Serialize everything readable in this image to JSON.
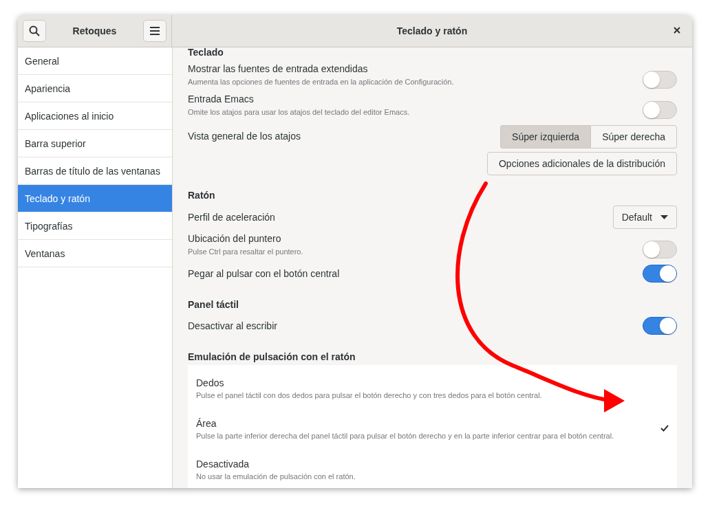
{
  "window": {
    "title": "Teclado y ratón"
  },
  "sidebar": {
    "title": "Retoques",
    "items": [
      {
        "label": "General",
        "selected": false
      },
      {
        "label": "Apariencia",
        "selected": false
      },
      {
        "label": "Aplicaciones al inicio",
        "selected": false
      },
      {
        "label": "Barra superior",
        "selected": false
      },
      {
        "label": "Barras de título de las ventanas",
        "selected": false
      },
      {
        "label": "Teclado y ratón",
        "selected": true
      },
      {
        "label": "Tipografías",
        "selected": false
      },
      {
        "label": "Ventanas",
        "selected": false
      }
    ]
  },
  "sections": [
    {
      "heading": "Teclado",
      "rows": [
        {
          "kind": "switch",
          "label": "Mostrar las fuentes de entrada extendidas",
          "description": "Aumenta las opciones de fuentes de entrada en la aplicación de Configuración.",
          "on": false
        },
        {
          "kind": "switch",
          "label": "Entrada Emacs",
          "description": "Omite los atajos para usar los atajos del teclado del editor Emacs.",
          "on": false
        },
        {
          "kind": "segmented",
          "label": "Vista general de los atajos",
          "options": [
            {
              "label": "Súper izquierda",
              "selected": true
            },
            {
              "label": "Súper derecha",
              "selected": false
            }
          ]
        },
        {
          "kind": "button",
          "label": "Opciones adicionales de la distribución"
        }
      ]
    },
    {
      "heading": "Ratón",
      "rows": [
        {
          "kind": "dropdown",
          "label": "Perfil de aceleración",
          "value": "Default"
        },
        {
          "kind": "switch",
          "label": "Ubicación del puntero",
          "description": "Pulse Ctrl para resaltar el puntero.",
          "on": false
        },
        {
          "kind": "switch",
          "label": "Pegar al pulsar con el botón central",
          "on": true
        }
      ]
    },
    {
      "heading": "Panel táctil",
      "rows": [
        {
          "kind": "switch",
          "label": "Desactivar al escribir",
          "on": true
        }
      ]
    },
    {
      "heading": "Emulación de pulsación con el ratón",
      "rows": [
        {
          "kind": "radio-list",
          "options": [
            {
              "label": "Dedos",
              "description": "Pulse el panel táctil con dos dedos para pulsar el botón derecho y con tres dedos para el botón central.",
              "selected": false
            },
            {
              "label": "Área",
              "description": "Pulse la parte inferior derecha del panel táctil para pulsar el botón derecho y en la parte inferior centrar para el botón central.",
              "selected": true
            },
            {
              "label": "Desactivada",
              "description": "No usar la emulación de pulsación con el ratón.",
              "selected": false
            }
          ]
        }
      ]
    }
  ]
}
